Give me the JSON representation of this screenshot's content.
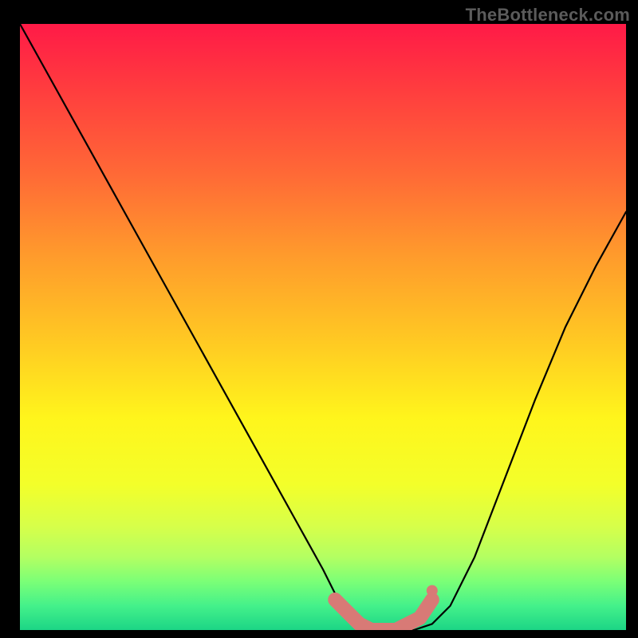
{
  "watermark": "TheBottleneck.com",
  "colors": {
    "background": "#000000",
    "curve": "#000000",
    "marker": "#d87a76",
    "gradient_top": "#ff1a47",
    "gradient_mid": "#ffe21e",
    "gradient_bottom": "#1cd586"
  },
  "chart_data": {
    "type": "line",
    "title": "",
    "xlabel": "",
    "ylabel": "",
    "xlim": [
      0,
      100
    ],
    "ylim": [
      0,
      100
    ],
    "grid": false,
    "legend": false,
    "series": [
      {
        "name": "curve",
        "x": [
          0,
          5,
          10,
          15,
          20,
          25,
          30,
          35,
          40,
          45,
          50,
          53,
          56,
          59,
          62,
          65,
          68,
          71,
          75,
          80,
          85,
          90,
          95,
          100
        ],
        "values": [
          100,
          91,
          82,
          73,
          64,
          55,
          46,
          37,
          28,
          19,
          10,
          4,
          1,
          0,
          0,
          0,
          1,
          4,
          12,
          25,
          38,
          50,
          60,
          69
        ]
      }
    ],
    "markers": {
      "name": "highlight",
      "x": [
        52,
        54,
        56,
        58,
        60,
        62,
        64,
        66,
        68
      ],
      "values": [
        5,
        3,
        1,
        0,
        0,
        0,
        1,
        2,
        5
      ],
      "style": "rounded-thick"
    }
  }
}
